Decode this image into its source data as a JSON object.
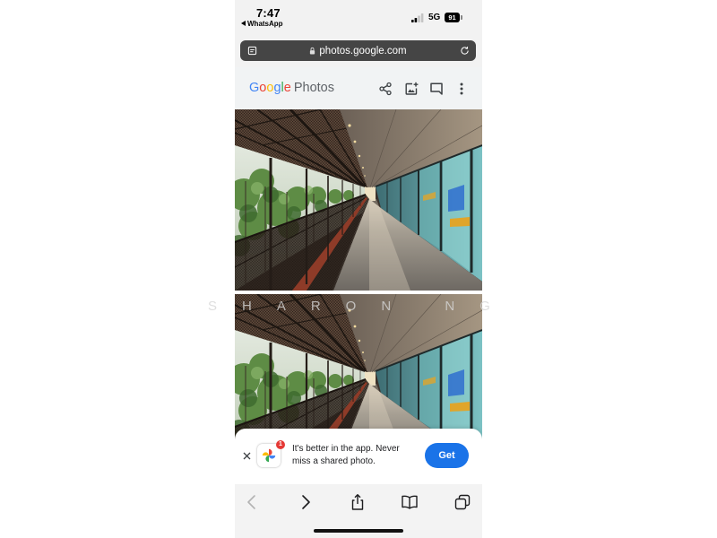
{
  "status_bar": {
    "time": "7:47",
    "back_app": "WhatsApp",
    "network": "5G",
    "battery": "91",
    "icons": [
      "back-to-app-icon",
      "signal-icon",
      "battery-icon"
    ]
  },
  "browser": {
    "url": "photos.google.com",
    "icons": [
      "page-menu-icon",
      "lock-icon",
      "reload-icon"
    ]
  },
  "header": {
    "brand_letters": [
      "G",
      "o",
      "o",
      "g",
      "l",
      "e"
    ],
    "brand_colors": [
      "#4285f4",
      "#ea4335",
      "#fbbc05",
      "#4285f4",
      "#34a853",
      "#ea4335"
    ],
    "brand_product": "Photos",
    "actions": [
      "share-icon",
      "add-to-album-icon",
      "comment-icon",
      "more-vert-icon"
    ]
  },
  "watermark": "SHARON NG",
  "banner": {
    "message_line1": "It's better in the app. Never",
    "message_line2": "miss a shared photo.",
    "badge": "1",
    "button": "Get",
    "icons": [
      "close-icon",
      "google-photos-app-icon"
    ]
  },
  "toolbar": {
    "icons": [
      "back-icon",
      "forward-icon",
      "share-icon",
      "bookmarks-icon",
      "tabs-icon"
    ]
  },
  "colors": {
    "url_bar": "#454545",
    "get_button": "#1a73e8",
    "badge": "#e53935",
    "header_icons": "#3c4043"
  }
}
